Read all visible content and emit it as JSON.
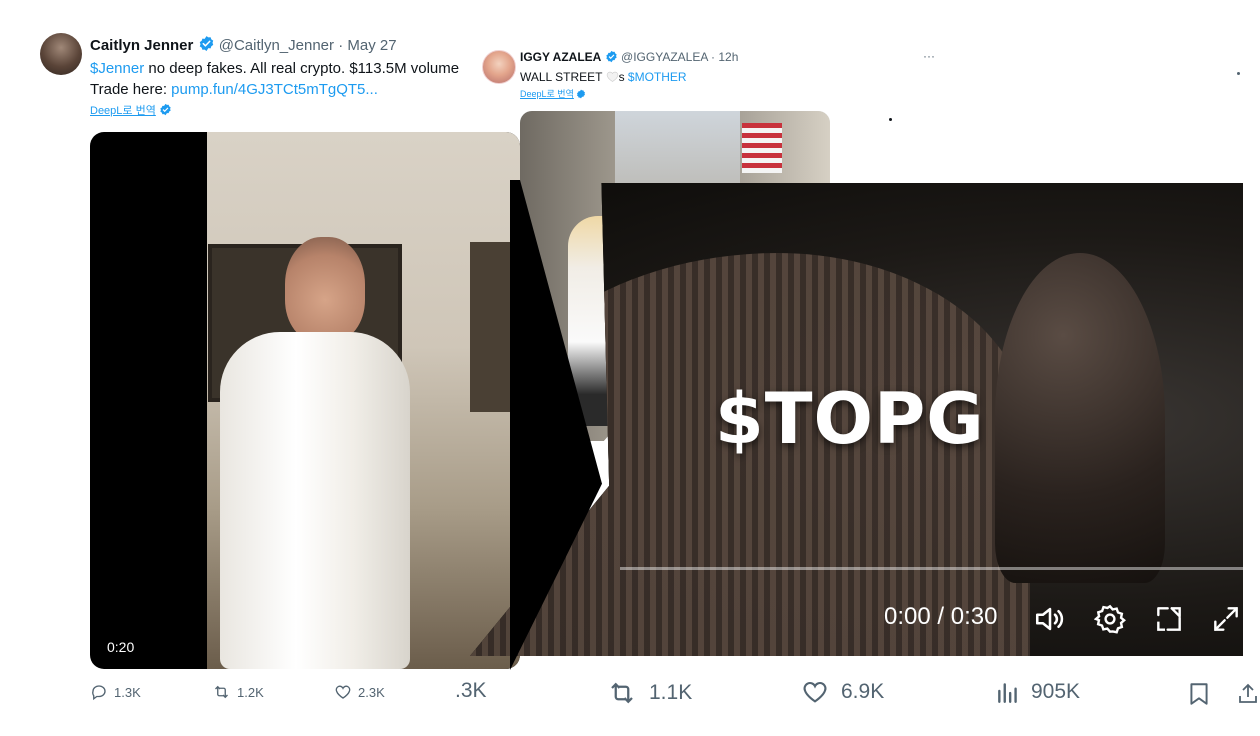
{
  "tweet1": {
    "name": "Caitlyn Jenner",
    "handle": "@Caitlyn_Jenner",
    "sep": "·",
    "date": "May 27",
    "text_cashtag": "$Jenner",
    "text_rest": " no deep fakes. All real crypto. $113.5M volume",
    "text_line2": "Trade here: ",
    "text_link": "pump.fun/4GJ3TCt5mTgQT5...",
    "translate": "DeepL로 번역",
    "video_time": "0:20",
    "actions": {
      "replies": "1.3K",
      "retweets": "1.2K",
      "likes": "2.3K"
    },
    "colors": {
      "link": "#1d9bf0",
      "verified": "#1d9bf0"
    }
  },
  "tweet2": {
    "name": "IGGY AZALEA",
    "handle": "@IGGYAZALEA",
    "sep": "·",
    "time": "12h",
    "more": "···",
    "text_start": "WALL STREET ",
    "text_middle": "s ",
    "text_cashtag": "$MOTHER",
    "translate": "DeepL로 번역"
  },
  "tweet3": {
    "video_title": "$TOPG",
    "time_display": "0:00 / 0:30",
    "progress": 0,
    "actions": {
      "replies": ".3K",
      "retweets": "1.1K",
      "likes": "6.9K",
      "views": "905K"
    },
    "icons": [
      "reply-icon",
      "retweet-icon",
      "like-icon",
      "views-icon",
      "bookmark-icon",
      "share-icon",
      "volume-icon",
      "settings-icon",
      "pip-icon",
      "fullscreen-icon"
    ]
  }
}
